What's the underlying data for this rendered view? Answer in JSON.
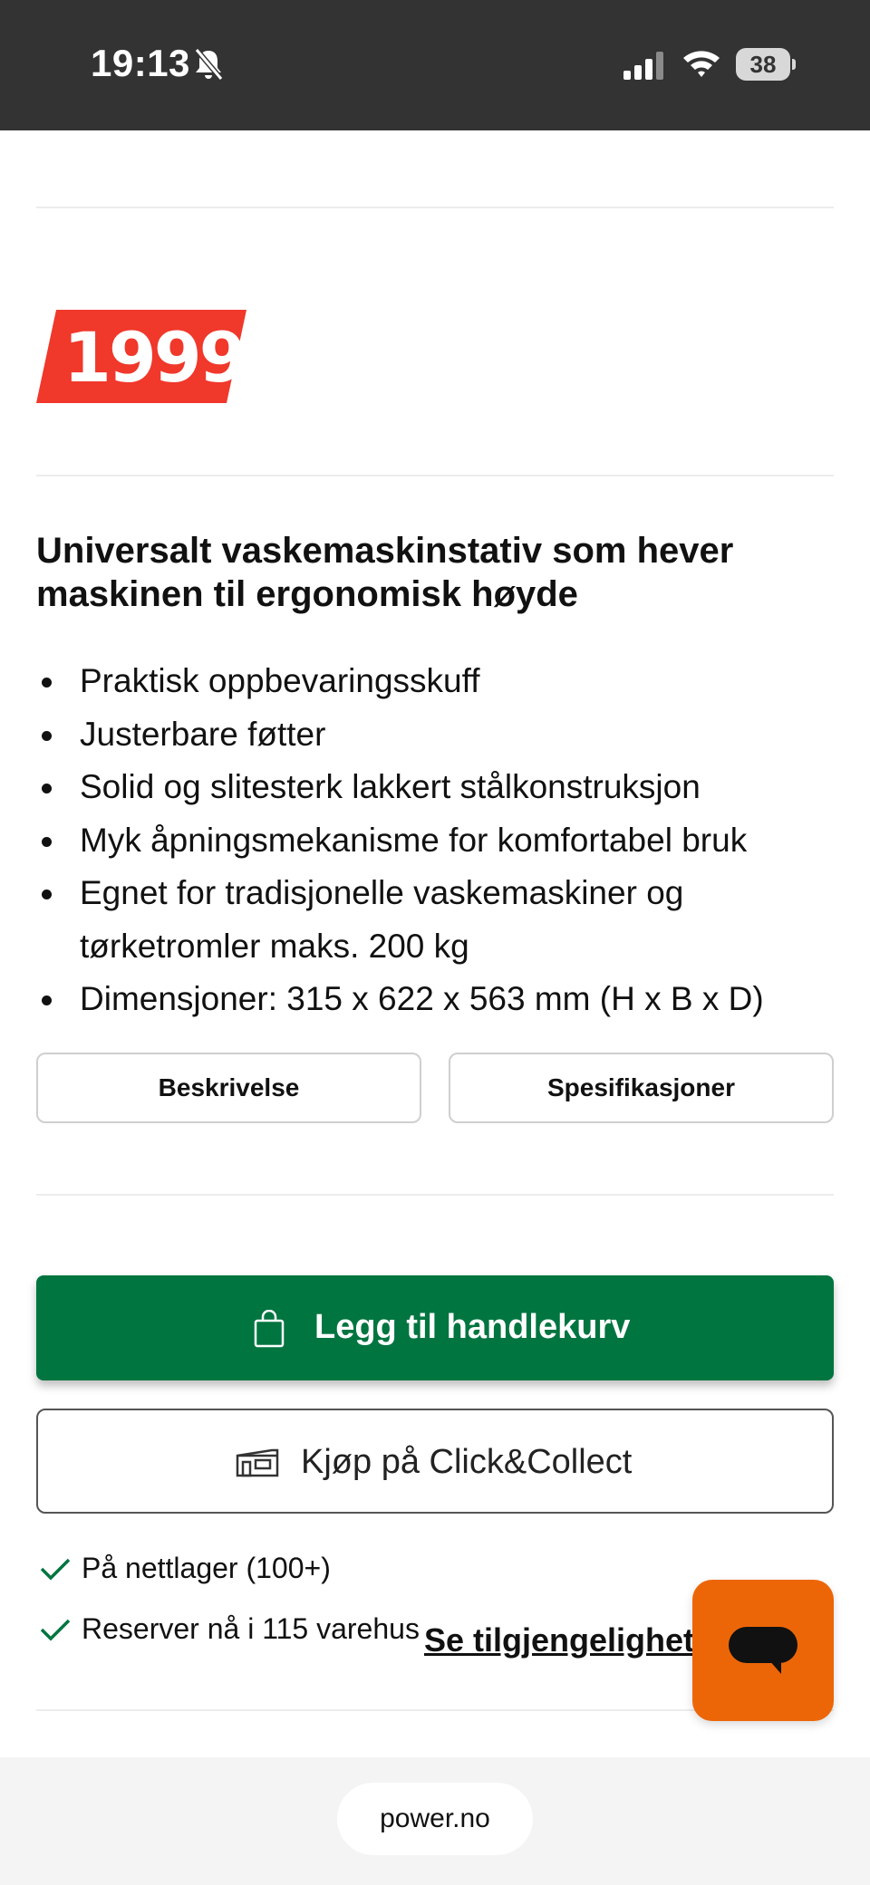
{
  "status_bar": {
    "time": "19:13",
    "battery": "38",
    "icons": [
      "bell-muted-icon",
      "signal-icon",
      "wifi-icon",
      "battery-icon"
    ]
  },
  "product": {
    "price": "1999",
    "heading": "Universalt vaskemaskinstativ som hever maskinen til ergonomisk høyde",
    "features": [
      "Praktisk oppbevaringsskuff",
      "Justerbare føtter",
      "Solid og slitesterk lakkert stålkonstruksjon",
      "Myk åpningsmekanisme for komfortabel bruk",
      "Egnet for tradisjonelle vaskemaskiner og tørketromler maks. 200 kg",
      "Dimensjoner: 315 x 622 x 563 mm (H x B x D)"
    ]
  },
  "tabs": {
    "description": "Beskrivelse",
    "specifications": "Spesifikasjoner"
  },
  "actions": {
    "add_to_cart": "Legg til handlekurv",
    "click_collect": "Kjøp på Click&Collect"
  },
  "availability": {
    "online": "På nettlager (100+)",
    "reserve": "Reserver nå i 115 varehus",
    "link": "Se tilgjengelighet"
  },
  "browser": {
    "url": "power.no"
  },
  "colors": {
    "price_red": "#f0382b",
    "cart_green": "#007540",
    "chat_orange": "#ec6608",
    "status_bar": "#333333"
  }
}
